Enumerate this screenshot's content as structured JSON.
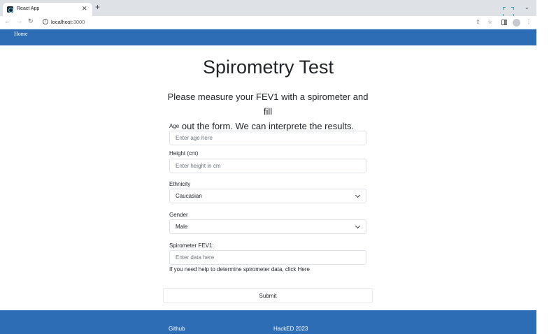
{
  "browser": {
    "tab_title": "React App",
    "url_host": "localhost",
    "url_port": ":3000",
    "icons": [
      "react-favicon",
      "close-icon",
      "plus-icon",
      "back-arrow-icon",
      "forward-arrow-icon",
      "reload-icon",
      "info-icon",
      "share-icon",
      "star-icon",
      "side-panel-icon",
      "profile-icon",
      "kebab-menu-icon",
      "chevron-down-icon"
    ]
  },
  "nav": {
    "home": "Home"
  },
  "page": {
    "title": "Spirometry Test",
    "intro_line1": "Please measure your FEV1 with a spirometer and fill",
    "intro_line2": "out the form. We can interprete the results."
  },
  "form": {
    "age": {
      "label": "Age",
      "placeholder": "Enter age here"
    },
    "height": {
      "label": "Height (cm)",
      "placeholder": "Enter height in cm"
    },
    "ethnicity": {
      "label": "Ethnicity",
      "value": "Caucasian"
    },
    "gender": {
      "label": "Gender",
      "value": "Male"
    },
    "fev1": {
      "label": "Spirometer FEV1:",
      "placeholder": "Enter data here"
    },
    "help_text": "If you need help to determine spirometer data, click Here",
    "submit": "Submit"
  },
  "footer": {
    "link": "Github",
    "copyright": "HackED 2023"
  },
  "colors": {
    "brand_blue": "#2d6db5",
    "chrome_gray": "#dee1e6"
  }
}
